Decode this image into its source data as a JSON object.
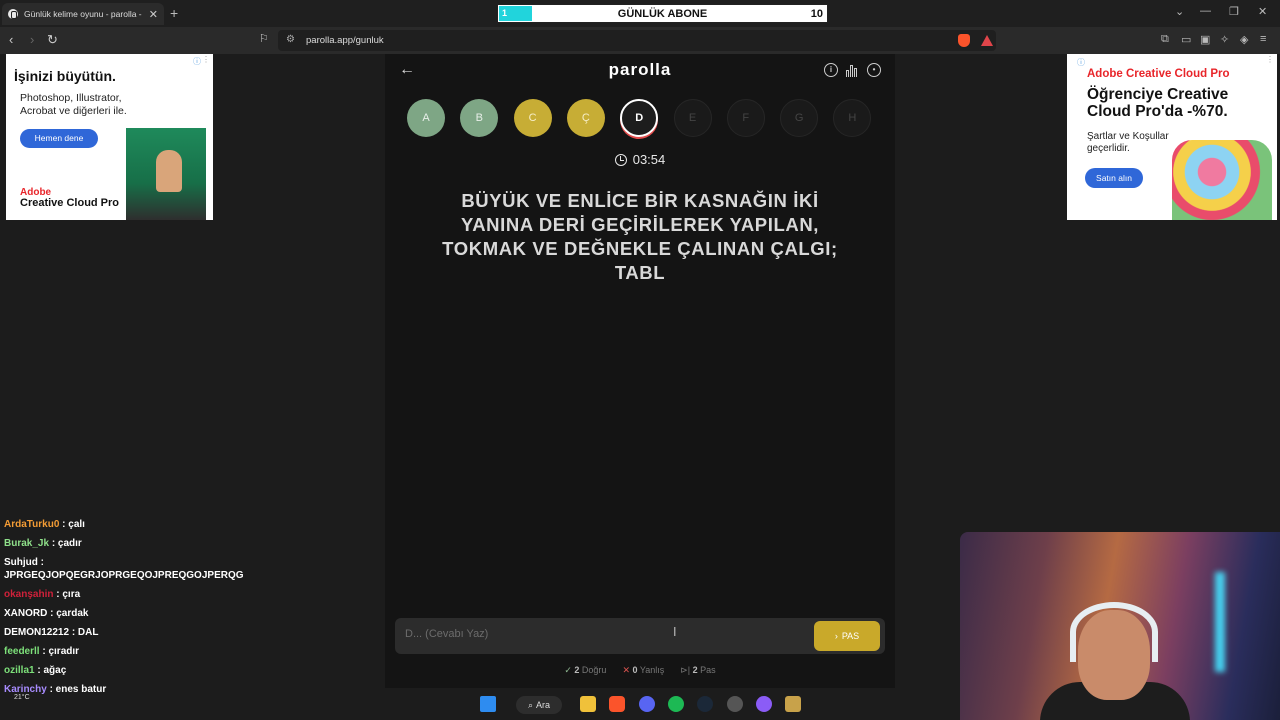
{
  "browser": {
    "tab_title": "Günlük kelime oyunu - parolla -",
    "url": "parolla.app/gunluk"
  },
  "overlay": {
    "left_label": "1",
    "title": "GÜNLÜK ABONE",
    "goal": "10",
    "progress_fraction": 0.1,
    "fill_color": "#21d4dc"
  },
  "app": {
    "brand": "parolla",
    "letters": [
      {
        "char": "A",
        "state": "correct"
      },
      {
        "char": "B",
        "state": "correct"
      },
      {
        "char": "C",
        "state": "passed"
      },
      {
        "char": "Ç",
        "state": "passed"
      },
      {
        "char": "D",
        "state": "current"
      },
      {
        "char": "E",
        "state": "pending"
      },
      {
        "char": "F",
        "state": "pending"
      },
      {
        "char": "G",
        "state": "pending"
      },
      {
        "char": "H",
        "state": "pending"
      }
    ],
    "timer": "03:54",
    "question": "BÜYÜK VE ENLİCE BİR KASNAĞIN İKİ YANINA DERİ GEÇİRİLEREK YAPILAN, TOKMAK VE DEĞNEKLE ÇALINAN ÇALGI; TABL",
    "answer_placeholder": "D... (Cevabı Yaz)",
    "pas_label": "PAS",
    "score": {
      "correct_count": "2",
      "correct_label": "Doğru",
      "wrong_count": "0",
      "wrong_label": "Yanlış",
      "pass_count": "2",
      "pass_label": "Pas"
    },
    "colors": {
      "correct": "#7ea685",
      "passed": "#c7ad35",
      "current_ring": "#e24b4b",
      "pas_button": "#c9a92a"
    }
  },
  "ads": {
    "left": {
      "headline": "İşinizi büyütün.",
      "body": "Photoshop, Illustrator, Acrobat ve diğerleri ile.",
      "cta": "Hemen dene",
      "logo_line1": "Adobe",
      "logo_line2": "Creative Cloud Pro"
    },
    "right": {
      "brand": "Adobe Creative Cloud Pro",
      "headline": "Öğrenciye Creative Cloud Pro'da -%70.",
      "body": "Şartlar ve Koşullar geçerlidir.",
      "cta": "Satın alın"
    }
  },
  "chat": [
    {
      "user": "ArdaTurku0",
      "msg": ": çalı",
      "color": "#f39c35"
    },
    {
      "user": "Burak_Jk",
      "msg": ": çadır",
      "color": "#8fe08a"
    },
    {
      "user": "Suhjud",
      "msg": ": JPRGEQJOPQEGRJOPRGEQOJPREQGOJPERQG",
      "color": "#ffffff"
    },
    {
      "user": "okanşahin",
      "msg": ": çıra",
      "color": "#d0213a"
    },
    {
      "user": "XANORD",
      "msg": ": çardak",
      "color": "#ffffff"
    },
    {
      "user": "DEMON12212",
      "msg": ": DAL",
      "color": "#ffffff"
    },
    {
      "user": "feederll",
      "msg": ": çıradır",
      "color": "#7de07a"
    },
    {
      "user": "ozilla1",
      "msg": ": ağaç",
      "color": "#7de07a"
    },
    {
      "user": "Karinchy",
      "msg": ": enes batur",
      "color": "#a88cff"
    }
  ],
  "taskbar": {
    "search_label": "Ara",
    "weather": "21°C"
  }
}
